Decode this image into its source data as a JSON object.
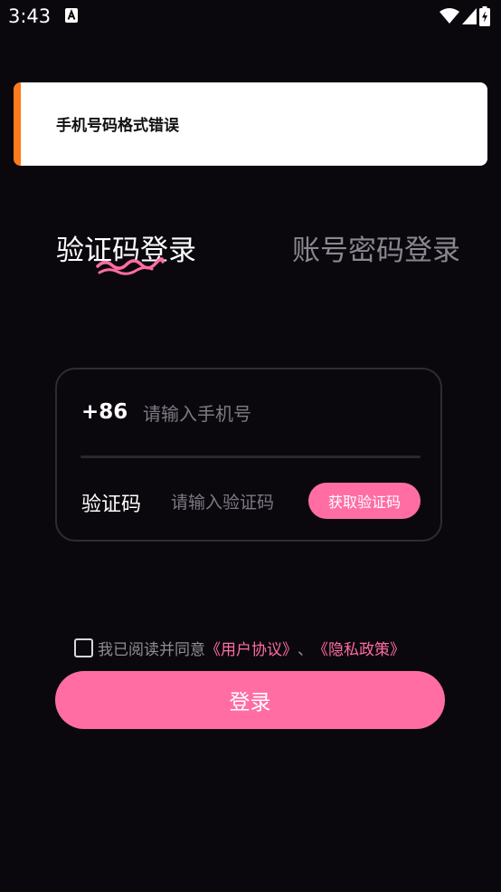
{
  "status_bar": {
    "time": "3:43"
  },
  "toast": {
    "message": "手机号码格式错误",
    "accent_color": "#ff7a1a"
  },
  "tabs": [
    {
      "label": "验证码登录",
      "active": true
    },
    {
      "label": "账号密码登录",
      "active": false
    }
  ],
  "form": {
    "country_code": "+86",
    "phone_placeholder": "请输入手机号",
    "phone_value": "",
    "code_label": "验证码",
    "code_placeholder": "请输入验证码",
    "code_value": "",
    "get_code_button": "获取验证码"
  },
  "agreement": {
    "checked": false,
    "prefix": "我已阅读并同意",
    "user_agreement": "《用户协议》",
    "separator": "、",
    "privacy_policy": "《隐私政策》"
  },
  "login_button": "登录",
  "colors": {
    "accent": "#ff6da3",
    "background": "#0b080d"
  }
}
